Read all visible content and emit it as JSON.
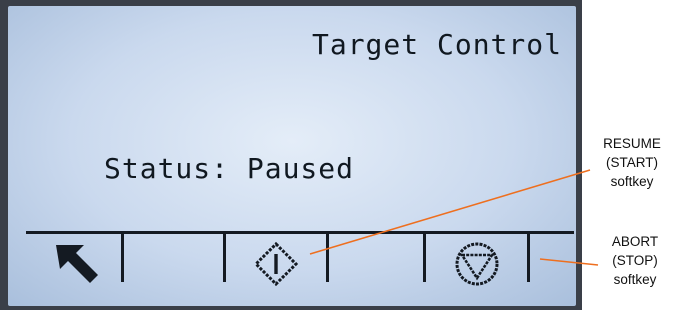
{
  "screen": {
    "title": "Target Control",
    "status_text": "Status: Paused"
  },
  "softkeys": [
    {
      "icon": "arrow-up-left-icon",
      "label": ""
    },
    {
      "icon": "empty",
      "label": ""
    },
    {
      "icon": "resume-start-diamond-icon",
      "label": ""
    },
    {
      "icon": "empty",
      "label": ""
    },
    {
      "icon": "abort-stop-triangle-icon",
      "label": ""
    }
  ],
  "callouts": {
    "resume": {
      "line1": "RESUME",
      "line2": "(START)",
      "line3": "softkey"
    },
    "abort": {
      "line1": "ABORT",
      "line2": "(STOP)",
      "line3": "softkey"
    }
  },
  "colors": {
    "lcd_background": "#cad9ee",
    "lcd_text": "#101820",
    "bezel": "#3a3f48",
    "callout_line": "#ee6f1f"
  }
}
